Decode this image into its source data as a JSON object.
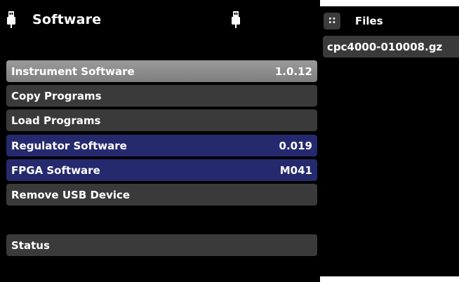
{
  "header": {
    "title": "Software",
    "left_icon": "usb-icon",
    "right_icon": "usb-icon"
  },
  "menu": {
    "items": [
      {
        "label": "Instrument Software",
        "value": "1.0.12"
      },
      {
        "label": "Copy Programs",
        "value": ""
      },
      {
        "label": "Load Programs",
        "value": ""
      },
      {
        "label": "Regulator Software",
        "value": "0.019"
      },
      {
        "label": "FPGA Software",
        "value": "M041"
      },
      {
        "label": "Remove USB Device",
        "value": ""
      },
      {
        "label": "Status",
        "value": ""
      }
    ]
  },
  "files": {
    "menu_icon": "grid-icon",
    "title": "Files",
    "items": [
      "cpc4000-010008.gz"
    ]
  },
  "colors": {
    "background": "#000000",
    "row": "#3a3a3a",
    "row_selected": "#8c8c8c",
    "row_info": "#252a6e",
    "text": "#ffffff"
  }
}
